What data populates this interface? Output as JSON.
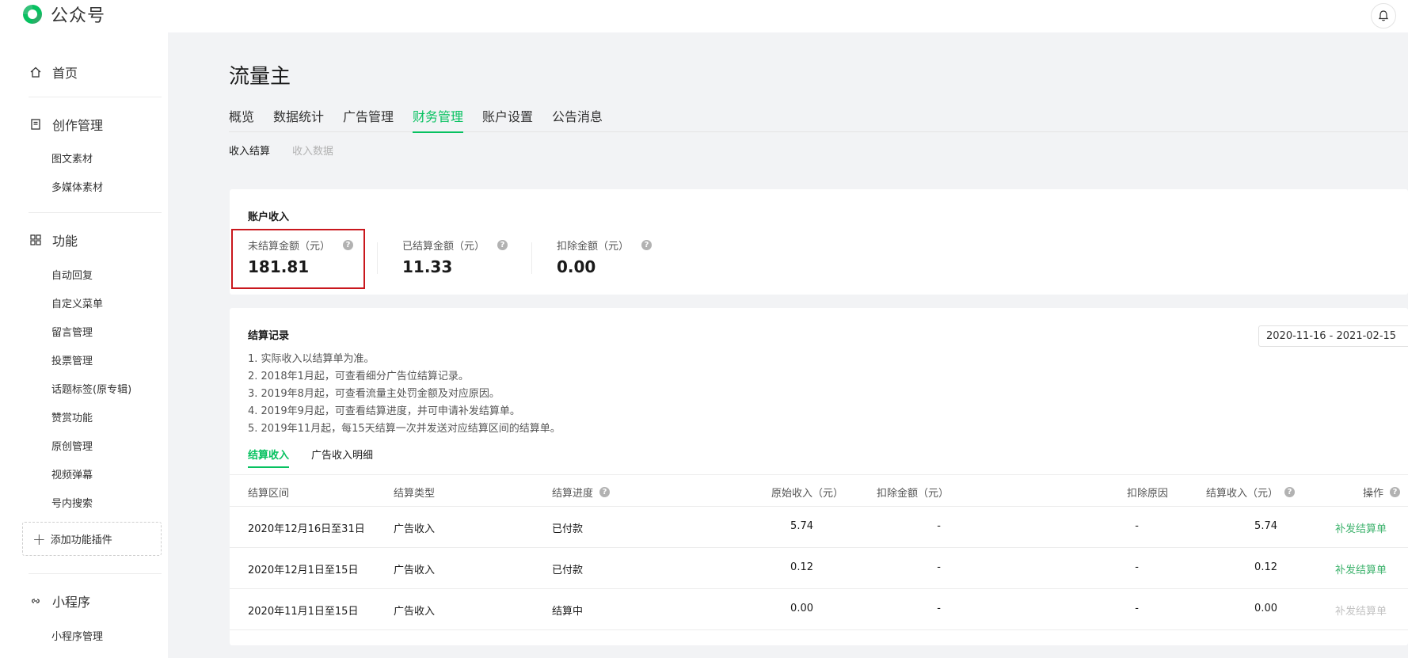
{
  "app": {
    "name": "公众号"
  },
  "sidebar": {
    "home": "首页",
    "creation": {
      "title": "创作管理",
      "items": [
        "图文素材",
        "多媒体素材"
      ]
    },
    "features": {
      "title": "功能",
      "items": [
        "自动回复",
        "自定义菜单",
        "留言管理",
        "投票管理",
        "话题标签(原专辑)",
        "赞赏功能",
        "原创管理",
        "视频弹幕",
        "号内搜索"
      ]
    },
    "add_plugin": "添加功能插件",
    "miniprogram": {
      "title": "小程序",
      "items": [
        "小程序管理"
      ]
    }
  },
  "page": {
    "title": "流量主",
    "tabs": [
      "概览",
      "数据统计",
      "广告管理",
      "财务管理",
      "账户设置",
      "公告消息"
    ],
    "active_tab": "财务管理",
    "subtabs": [
      "收入结算",
      "收入数据"
    ]
  },
  "account": {
    "title": "账户收入",
    "stats": [
      {
        "label": "未结算金额（元）",
        "value": "181.81"
      },
      {
        "label": "已结算金额（元）",
        "value": "11.33"
      },
      {
        "label": "扣除金额（元）",
        "value": "0.00"
      }
    ]
  },
  "records": {
    "title": "结算记录",
    "date_range": "2020-11-16 - 2021-02-15",
    "notes": [
      "1. 实际收入以结算单为准。",
      "2. 2018年1月起，可查看细分广告位结算记录。",
      "3. 2019年8月起，可查看流量主处罚金额及对应原因。",
      "4. 2019年9月起，可查看结算进度，并可申请补发结算单。",
      "5. 2019年11月起，每15天结算一次并发送对应结算区间的结算单。"
    ],
    "tabs": [
      "结算收入",
      "广告收入明细"
    ],
    "columns": [
      "结算区间",
      "结算类型",
      "结算进度",
      "原始收入（元）",
      "扣除金额（元）",
      "扣除原因",
      "结算收入（元）",
      "操作"
    ],
    "rows": [
      {
        "period": "2020年12月16日至31日",
        "type": "广告收入",
        "status": "已付款",
        "original": "5.74",
        "deduct": "-",
        "reason": "-",
        "settled": "5.74",
        "action": "补发结算单",
        "action_enabled": true
      },
      {
        "period": "2020年12月1日至15日",
        "type": "广告收入",
        "status": "已付款",
        "original": "0.12",
        "deduct": "-",
        "reason": "-",
        "settled": "0.12",
        "action": "补发结算单",
        "action_enabled": true
      },
      {
        "period": "2020年11月1日至15日",
        "type": "广告收入",
        "status": "结算中",
        "original": "0.00",
        "deduct": "-",
        "reason": "-",
        "settled": "0.00",
        "action": "补发结算单",
        "action_enabled": false
      }
    ]
  },
  "colors": {
    "accent": "#07c160",
    "highlight": "#c9171d"
  }
}
